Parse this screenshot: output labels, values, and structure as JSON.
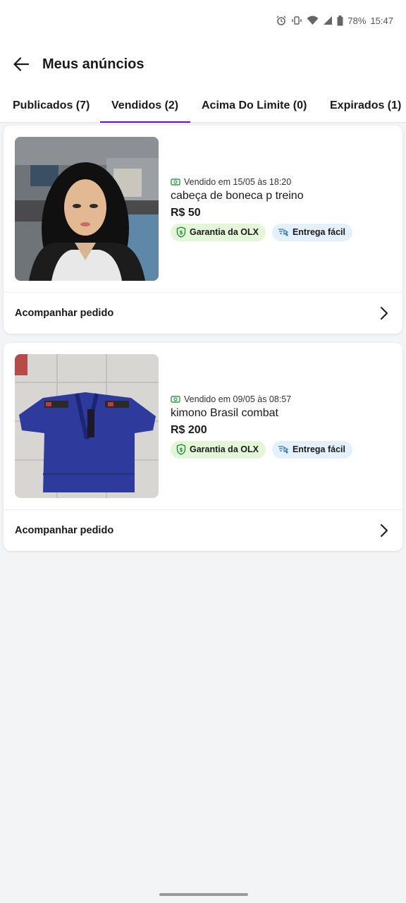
{
  "status_bar": {
    "battery": "78%",
    "time": "15:47",
    "icons": [
      "alarm-icon",
      "vibrate-icon",
      "wifi-icon",
      "signal-icon",
      "battery-icon"
    ]
  },
  "header": {
    "title": "Meus anúncios",
    "back_icon": "arrow-left-icon"
  },
  "tabs": [
    {
      "label": "Publicados (7)"
    },
    {
      "label": "Vendidos (2)",
      "active": true
    },
    {
      "label": "Acima Do Limite (0)"
    },
    {
      "label": "Expirados (1)"
    }
  ],
  "accent_color": "#6e0ad6",
  "listings": [
    {
      "sold": "Vendido em 15/05 às 18:20",
      "title": "cabeça de boneca p treino",
      "price": "R$ 50",
      "badge_guarantee": "Garantia da OLX",
      "badge_delivery": "Entrega fácil",
      "footer": "Acompanhar pedido"
    },
    {
      "sold": "Vendido em 09/05 às 08:57",
      "title": "kimono Brasil combat",
      "price": "R$ 200",
      "badge_guarantee": "Garantia da OLX",
      "badge_delivery": "Entrega fácil",
      "footer": "Acompanhar pedido"
    }
  ]
}
